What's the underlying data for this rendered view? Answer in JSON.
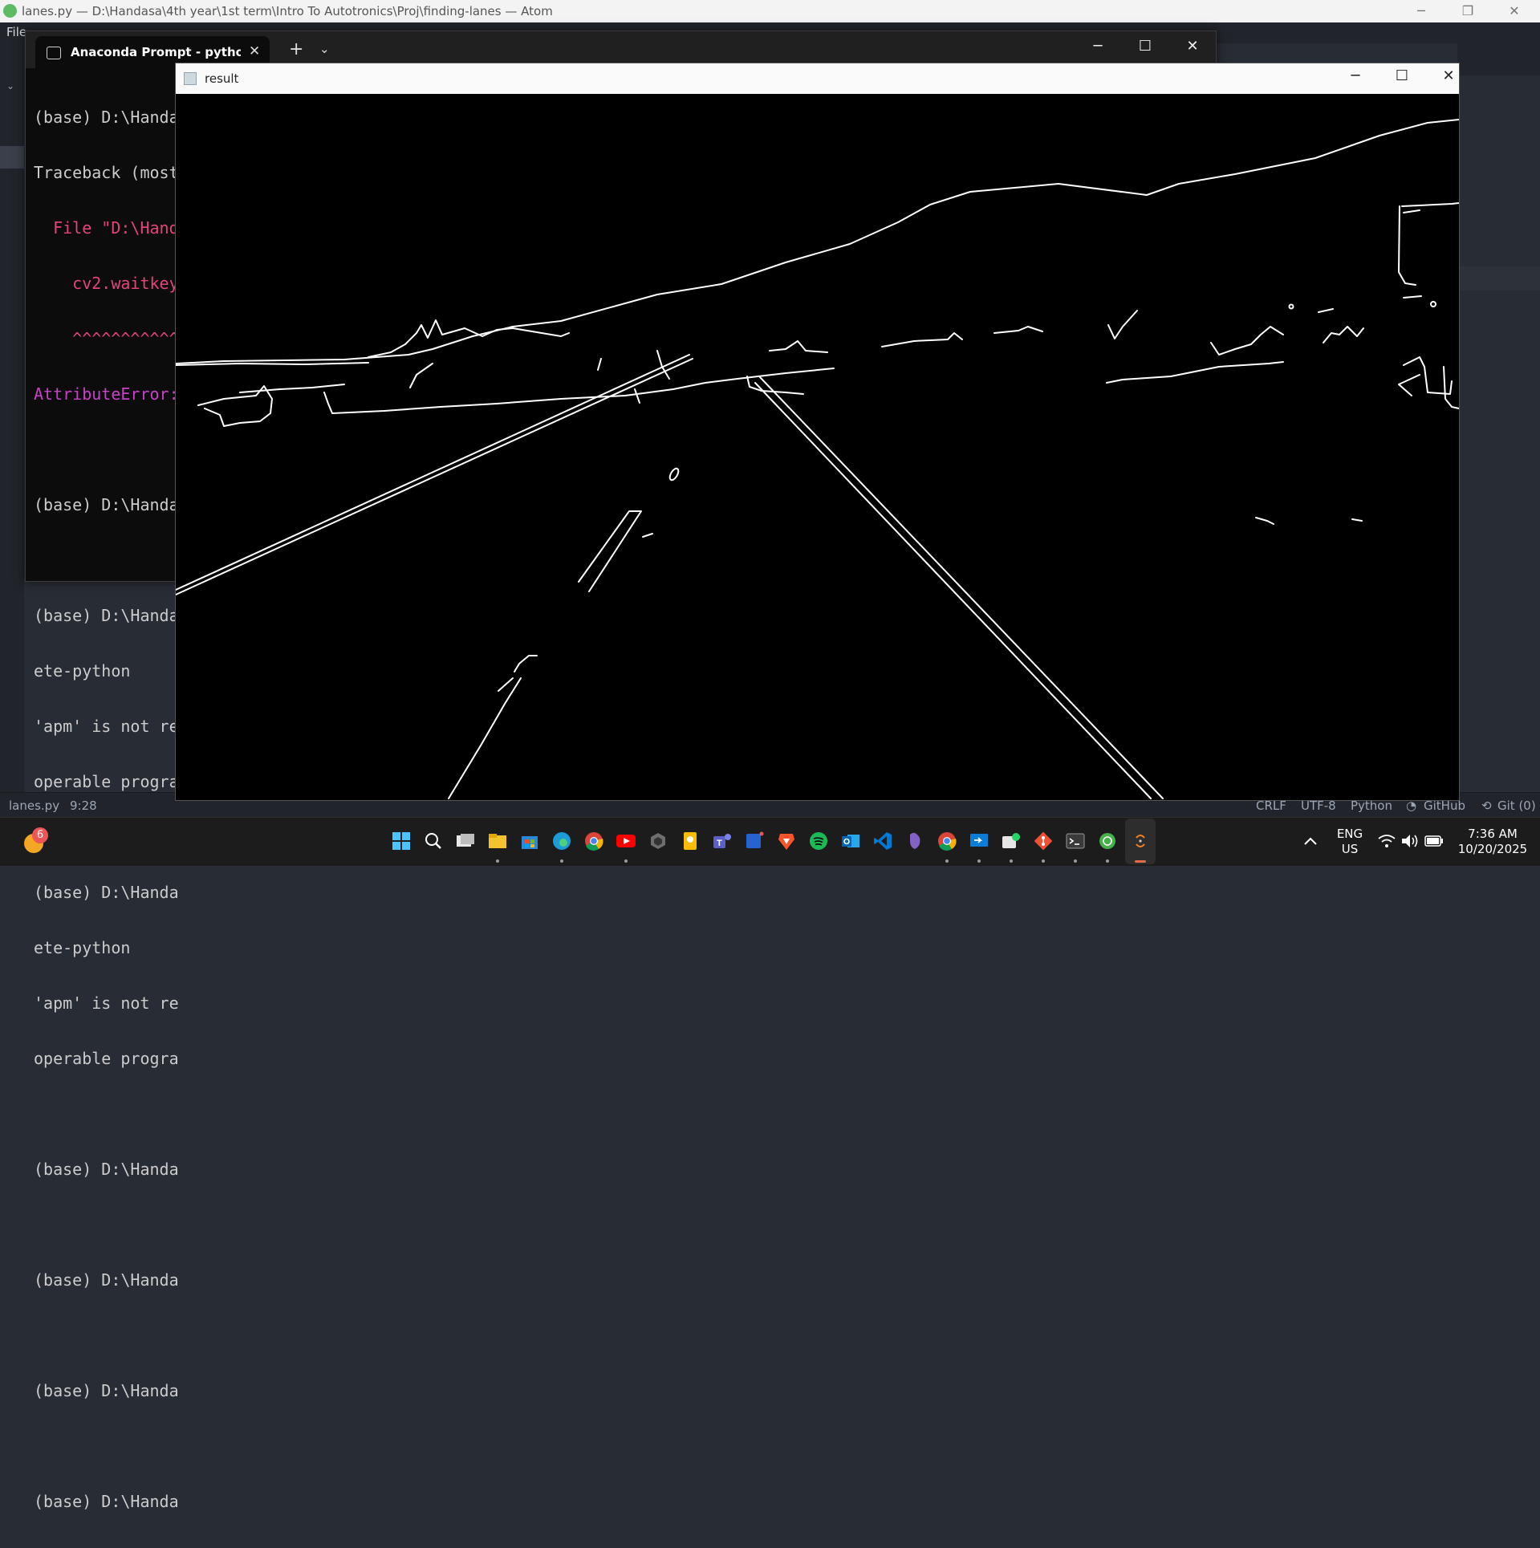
{
  "atom": {
    "title": "lanes.py — D:\\Handasa\\4th year\\1st term\\Intro To Autotronics\\Proj\\finding-lanes — Atom",
    "menu_file": "File",
    "window_controls": [
      "─",
      "❐",
      "✕"
    ]
  },
  "statusbar": {
    "file": "lanes.py",
    "cursor": "9:28",
    "line_ending": "CRLF",
    "encoding": "UTF-8",
    "grammar": "Python",
    "github": "GitHub",
    "git": "Git (0)"
  },
  "terminal": {
    "tab_label": "Anaconda Prompt - python la",
    "tab_close": "✕",
    "new_tab": "+",
    "dropdown": "⌄",
    "window_controls": [
      "─",
      "☐",
      "✕"
    ],
    "lines": [
      "(base) D:\\Handa",
      "Traceback (most",
      "  File \"D:\\Hand",
      "    cv2.waitkey",
      "    ^^^^^^^^^^^",
      "AttributeError:",
      "",
      "(base) D:\\Handa",
      "",
      "(base) D:\\Handa",
      "ete-python",
      "'apm' is not re",
      "operable progra",
      "",
      "(base) D:\\Handa",
      "ete-python",
      "'apm' is not re",
      "operable progra",
      "",
      "(base) D:\\Handa",
      "",
      "(base) D:\\Handa",
      "",
      "(base) D:\\Handa",
      "",
      "(base) D:\\Handa"
    ]
  },
  "result_window": {
    "title": "result",
    "window_controls": [
      "─",
      "☐",
      "✕"
    ],
    "image": "canny-edge-road"
  },
  "taskbar": {
    "weather_badge": "6",
    "icons": [
      "windows-start-icon",
      "search-icon",
      "task-view-icon",
      "file-explorer-icon",
      "ms-store-icon",
      "edge-icon",
      "chrome-icon",
      "youtube-icon",
      "github-desktop-icon",
      "google-keep-icon",
      "teams-icon",
      "todo-icon",
      "brave-icon",
      "spotify-icon",
      "outlook-icon",
      "vscode-icon",
      "visual-studio-icon",
      "chrome-alt-icon",
      "remote-desktop-icon",
      "whatsapp-icon",
      "git-icon",
      "terminal-icon",
      "anaconda-icon",
      "python-icon"
    ],
    "language_line1": "ENG",
    "language_line2": "US",
    "time": "7:36 AM",
    "date": "10/20/2025"
  }
}
